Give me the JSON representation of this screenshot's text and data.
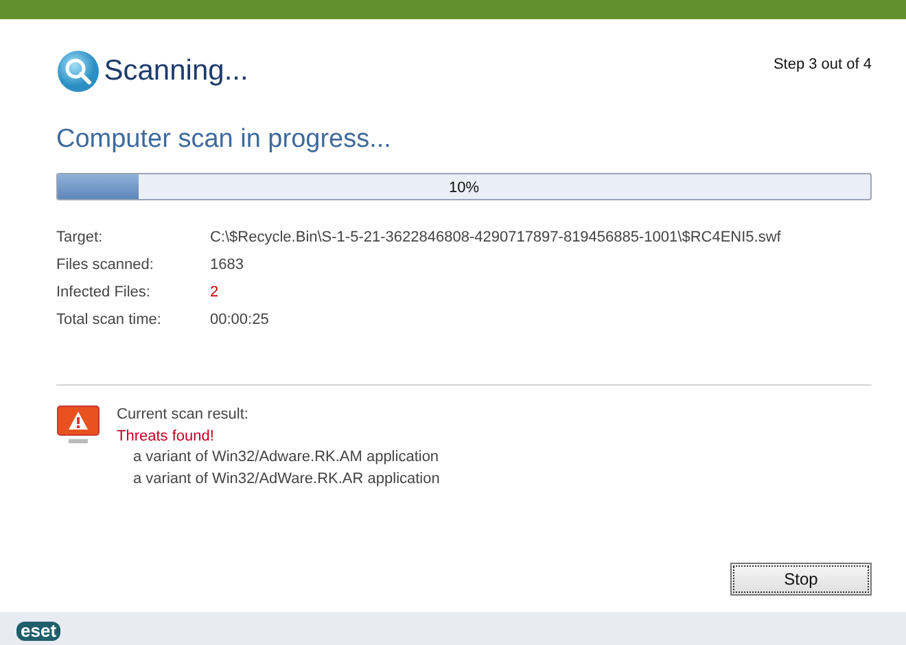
{
  "header": {
    "title": "Scanning...",
    "step": "Step 3 out of 4"
  },
  "heading": "Computer scan in progress...",
  "progress": {
    "level": 0.1,
    "label": "10%"
  },
  "details": [
    {
      "label": "Target:",
      "value": "C:\\$Recycle.Bin\\S-1-5-21-3622846808-4290717897-819456885-1001\\$RC4ENI5.swf",
      "alert": false
    },
    {
      "label": "Files scanned:",
      "value": "1683",
      "alert": false
    },
    {
      "label": "Infected Files:",
      "value": "2",
      "alert": true
    },
    {
      "label": "Total scan time:",
      "value": "00:00:25",
      "alert": false
    }
  ],
  "result": {
    "title": "Current scan result:",
    "status": "Threats found!",
    "threats": [
      "a variant of Win32/Adware.RK.AM application",
      "a variant of Win32/AdWare.RK.AR application"
    ]
  },
  "buttons": [
    "Stop"
  ],
  "footer": {
    "logo": "eset"
  }
}
